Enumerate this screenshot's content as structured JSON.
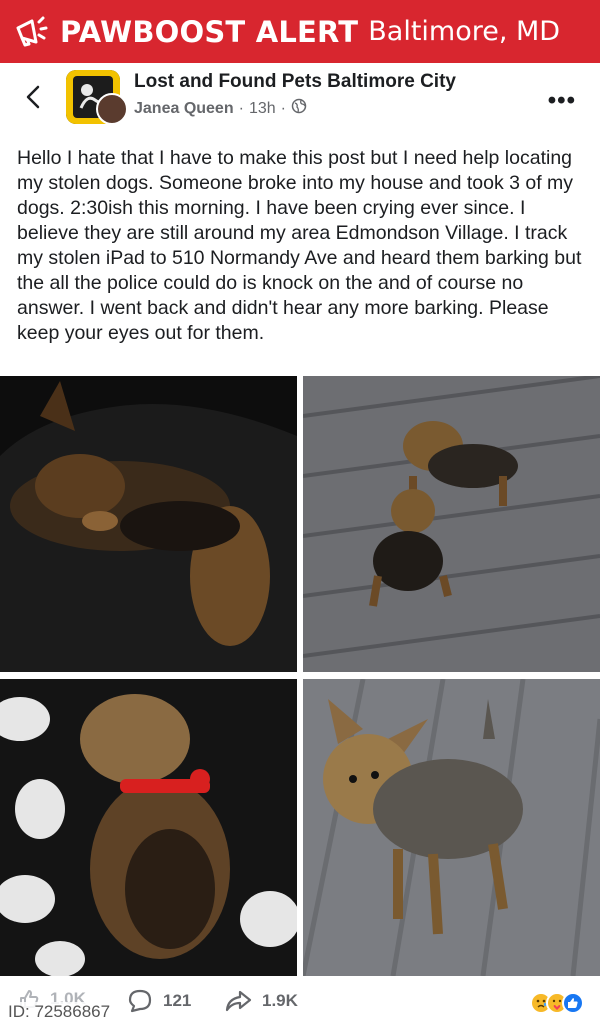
{
  "banner": {
    "brand": "PAWBOOST ALERT",
    "city": "Baltimore, MD",
    "color": "#d8262f"
  },
  "post": {
    "group_name": "Lost and Found Pets Baltimore City",
    "author": "Janea Queen",
    "time": "13h",
    "privacy_icon": "globe-icon",
    "text": "Hello I hate that I have to make this post but I need help locating my stolen dogs. Someone broke into my house and took 3 of my dogs. 2:30ish this morning. I have been crying ever since. I believe they are still around my area Edmondson Village. I track my stolen iPad to 510 Normandy Ave and heard them barking but the all the police could do is knock on the and of course no answer. I went back and didn't hear any more barking. Please keep your eyes out for them."
  },
  "photos": [
    {
      "label": "Yorkie lying on person's lap"
    },
    {
      "label": "Two Yorkies on wooden deck"
    },
    {
      "label": "Yorkie with red collar on black and white blanket"
    },
    {
      "label": "Yorkie standing on gray deck"
    }
  ],
  "footer": {
    "likes": "1.0K",
    "comments": "121",
    "shares": "1.9K",
    "reactions": [
      "sad",
      "care",
      "like"
    ]
  },
  "id_label": "ID: 72586867"
}
